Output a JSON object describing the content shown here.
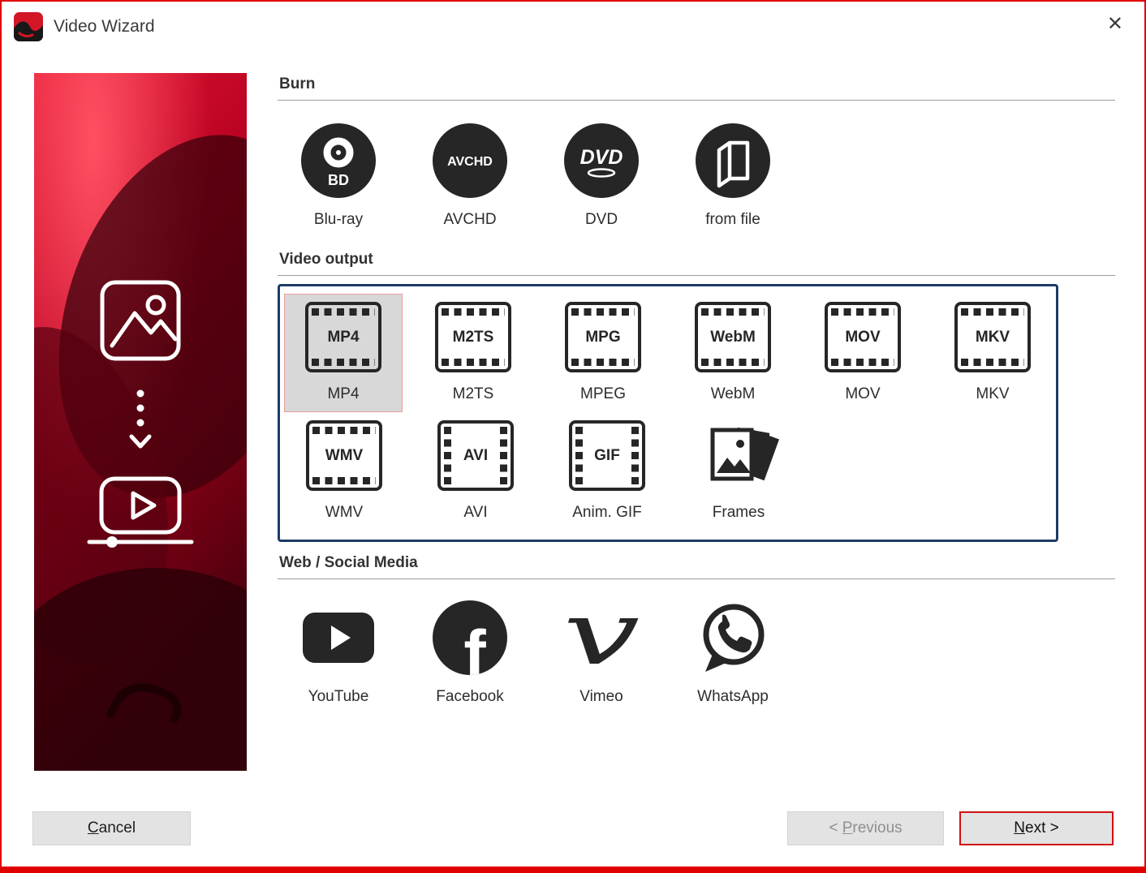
{
  "window": {
    "title": "Video Wizard",
    "close_glyph": "✕"
  },
  "sections": {
    "burn": {
      "label": "Burn",
      "items": [
        {
          "label": "Blu-ray",
          "icon": "bluray-disc-icon"
        },
        {
          "label": "AVCHD",
          "icon": "avchd-disc-icon",
          "icon_text": "AVCHD"
        },
        {
          "label": "DVD",
          "icon": "dvd-disc-icon",
          "icon_text": "DVD"
        },
        {
          "label": "from file",
          "icon": "from-file-icon"
        }
      ]
    },
    "video_output": {
      "label": "Video output",
      "items": [
        {
          "label": "MP4",
          "icon_text": "MP4",
          "selected": true
        },
        {
          "label": "M2TS",
          "icon_text": "M2TS",
          "selected": false
        },
        {
          "label": "MPEG",
          "icon_text": "MPG",
          "selected": false
        },
        {
          "label": "WebM",
          "icon_text": "WebM",
          "selected": false
        },
        {
          "label": "MOV",
          "icon_text": "MOV",
          "selected": false
        },
        {
          "label": "MKV",
          "icon_text": "MKV",
          "selected": false
        },
        {
          "label": "WMV",
          "icon_text": "WMV",
          "selected": false
        },
        {
          "label": "AVI",
          "icon_text": "AVI",
          "selected": false
        },
        {
          "label": "Anim. GIF",
          "icon_text": "GIF",
          "selected": false
        },
        {
          "label": "Frames",
          "icon": "frames-icon",
          "selected": false
        }
      ]
    },
    "web": {
      "label": "Web / Social Media",
      "items": [
        {
          "label": "YouTube",
          "icon": "youtube-icon"
        },
        {
          "label": "Facebook",
          "icon": "facebook-icon"
        },
        {
          "label": "Vimeo",
          "icon": "vimeo-icon"
        },
        {
          "label": "WhatsApp",
          "icon": "whatsapp-icon"
        }
      ]
    }
  },
  "buttons": {
    "cancel": {
      "pre": "",
      "accel": "C",
      "post": "ancel"
    },
    "previous": {
      "pre": "< ",
      "accel": "P",
      "post": "revious"
    },
    "next": {
      "pre": "",
      "accel": "N",
      "post": "ext >"
    }
  },
  "colors": {
    "window_border": "#e10000",
    "group_border": "#1d3b66",
    "selection_bg": "#d8d8d8",
    "selection_border": "#e8a09a",
    "icon_dark": "#262626"
  }
}
